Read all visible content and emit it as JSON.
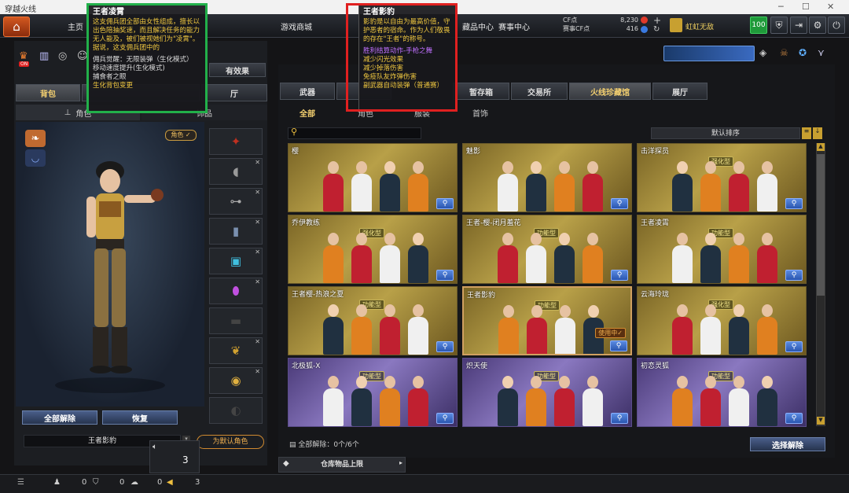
{
  "window": {
    "title": "穿越火线",
    "controls": [
      "─",
      "☐",
      "✕"
    ]
  },
  "nav": {
    "items": [
      "主页",
      "装备",
      "游戏商城",
      "藏品中心",
      "赛事中心"
    ],
    "currency": {
      "cf_label": "CF点",
      "cf_value": "8,230",
      "cfc_label": "赛事CF点",
      "cfc_value": "416"
    },
    "player_name": "虹虹无敌",
    "level_badge": "100"
  },
  "left": {
    "on_badge": "ON",
    "all_effects_label": "有效果",
    "tabs": [
      "背包",
      "",
      "厅"
    ],
    "subtabs": [
      "角色",
      "饰品"
    ],
    "role_tag": "角色 ✓",
    "unequip_all": "全部解除",
    "restore": "恢复",
    "current_role": "王者影豹",
    "default_role": "为默认角色",
    "volume_value": "3"
  },
  "right": {
    "tabs": [
      "武器",
      "",
      "暂存箱",
      "交易所",
      "火线珍藏馆",
      "展厅"
    ],
    "subtabs": [
      "全部",
      "角色",
      "服装",
      "首饰"
    ],
    "sort_label": "默认排序",
    "search_placeholder": "",
    "cards": [
      {
        "name": "樱",
        "badge": "",
        "variant": "gold"
      },
      {
        "name": "魅影",
        "badge": "",
        "variant": "gold"
      },
      {
        "name": "击洋探员",
        "badge": "强化型",
        "variant": "gold"
      },
      {
        "name": "乔伊教练",
        "badge": "强化型",
        "variant": "gold"
      },
      {
        "name": "王者-樱-闭月羞花",
        "badge": "功能型",
        "variant": "gold"
      },
      {
        "name": "王者凌霄",
        "badge": "功能型",
        "variant": "gold"
      },
      {
        "name": "王者樱-热浪之夏",
        "badge": "功能型",
        "variant": "gold"
      },
      {
        "name": "王者影豹",
        "badge": "功能型",
        "variant": "gold",
        "in_use": "使用中✓"
      },
      {
        "name": "云海玲珑",
        "badge": "强化型",
        "variant": "gold"
      },
      {
        "name": "北极狐-X",
        "badge": "功能型",
        "variant": "purple"
      },
      {
        "name": "炽天使",
        "badge": "功能型",
        "variant": "purple"
      },
      {
        "name": "初恋灵狐",
        "badge": "功能型",
        "variant": "purple"
      }
    ],
    "footer": {
      "unequip_count": "全部解除：0个/6个",
      "select_unequip": "选择解除",
      "warehouse_cap": "仓库物品上限"
    }
  },
  "tooltip_left": {
    "title": "王者凌霄",
    "desc": "这支佣兵团全部由女性组成，擅长以出色陪抽奖速，而且解决任务的能力无人能及，被们被视她们为\"凌霄\"。据说，这支佣兵团中的",
    "lines": [
      "佣兵觉醒：无限装弹（生化模式）",
      "移动速度提升(生化模式)",
      "捕食者之眼",
      "生化背包变更"
    ]
  },
  "tooltip_right": {
    "title": "王者影豹",
    "desc": "影豹是以自由为最高价值，守护恶者的宿命。作为人们敬畏的存在\"王者\"的称号。",
    "purple_line": "胜利结算动作-手枪之舞",
    "lines": [
      "减少闪光效果",
      "减少掉落伤害",
      "免疫队友炸弹伤害",
      "副武器自动装弹（普通赛）"
    ]
  },
  "bottom": {
    "counts": [
      "0",
      "0",
      "0",
      "3"
    ]
  },
  "colors": {
    "accent_orange": "#d35820",
    "highlight_green": "#22b04a",
    "highlight_red": "#e02020"
  }
}
